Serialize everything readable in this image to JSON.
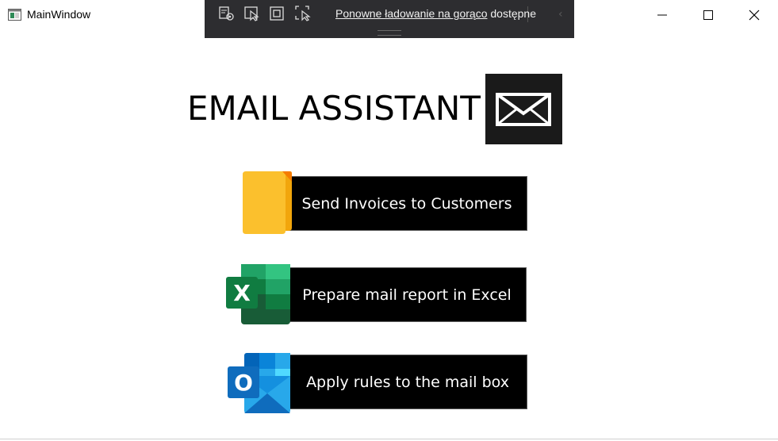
{
  "window": {
    "title": "MainWindow",
    "app_icon": "wpf-window-icon",
    "controls": {
      "minimize_icon": "minimize-icon",
      "maximize_icon": "maximize-icon",
      "close_icon": "close-icon"
    }
  },
  "hot_reload_toolbar": {
    "tools": [
      "visual-tree-icon",
      "select-element-icon",
      "display-layout-adorners-icon",
      "track-focused-element-icon"
    ],
    "link_text": "Ponowne ładowanie na gorąco",
    "status_text": "dostępne",
    "collapse_icon": "chevron-left-icon"
  },
  "main": {
    "heading": "EMAIL ASSISTANT",
    "logo_icon": "envelope-icon",
    "actions": [
      {
        "label": "Send Invoices to Customers",
        "icon": "folder-icon",
        "color": "#fbc02d"
      },
      {
        "label": "Prepare mail report in Excel",
        "icon": "excel-icon",
        "color": "#107c41"
      },
      {
        "label": "Apply rules to the mail box",
        "icon": "outlook-icon",
        "color": "#0f6cbd"
      }
    ]
  }
}
